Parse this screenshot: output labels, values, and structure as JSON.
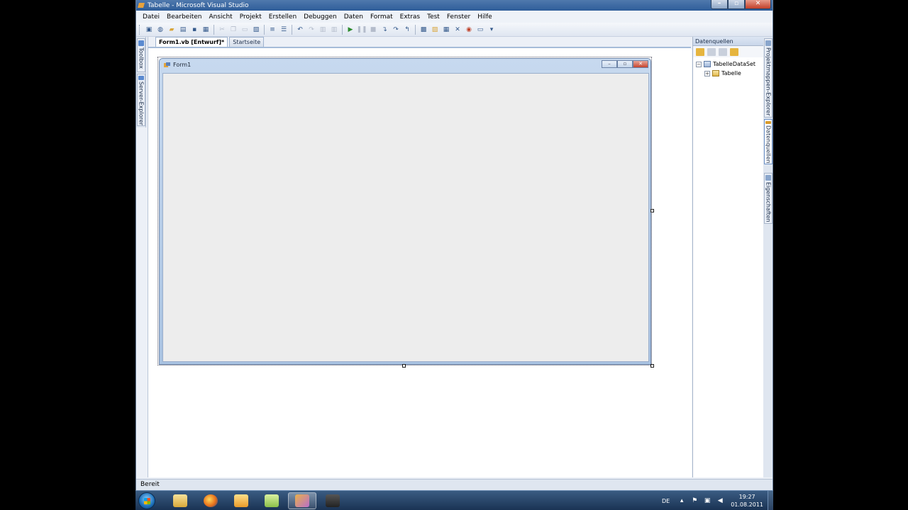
{
  "window": {
    "title": "Tabelle - Microsoft Visual Studio",
    "minimize": "–",
    "maximize": "▫",
    "close": "✕"
  },
  "menu": [
    "Datei",
    "Bearbeiten",
    "Ansicht",
    "Projekt",
    "Erstellen",
    "Debuggen",
    "Daten",
    "Format",
    "Extras",
    "Test",
    "Fenster",
    "Hilfe"
  ],
  "left_tabs": {
    "toolbox": "Toolbox",
    "server_explorer": "Server-Explorer"
  },
  "doc_tabs": {
    "active": "Form1.vb [Entwurf]*",
    "inactive": "Startseite"
  },
  "form": {
    "title": "Form1"
  },
  "datasources": {
    "header": "Datenquellen",
    "dataset": "TabelleDataSet",
    "table": "Tabelle",
    "collapse": "−",
    "expand": "+"
  },
  "right_tabs": {
    "solution_explorer": "Projektmappen-Explorer",
    "datasources": "Datenquellen",
    "properties": "Eigenschaften"
  },
  "status": {
    "text": "Bereit"
  },
  "taskbar": {
    "lang": "DE",
    "time": "19:27",
    "date": "01.08.2011"
  },
  "colors": {
    "accent": "#2f5d99",
    "designer_surface": "#ededed"
  }
}
